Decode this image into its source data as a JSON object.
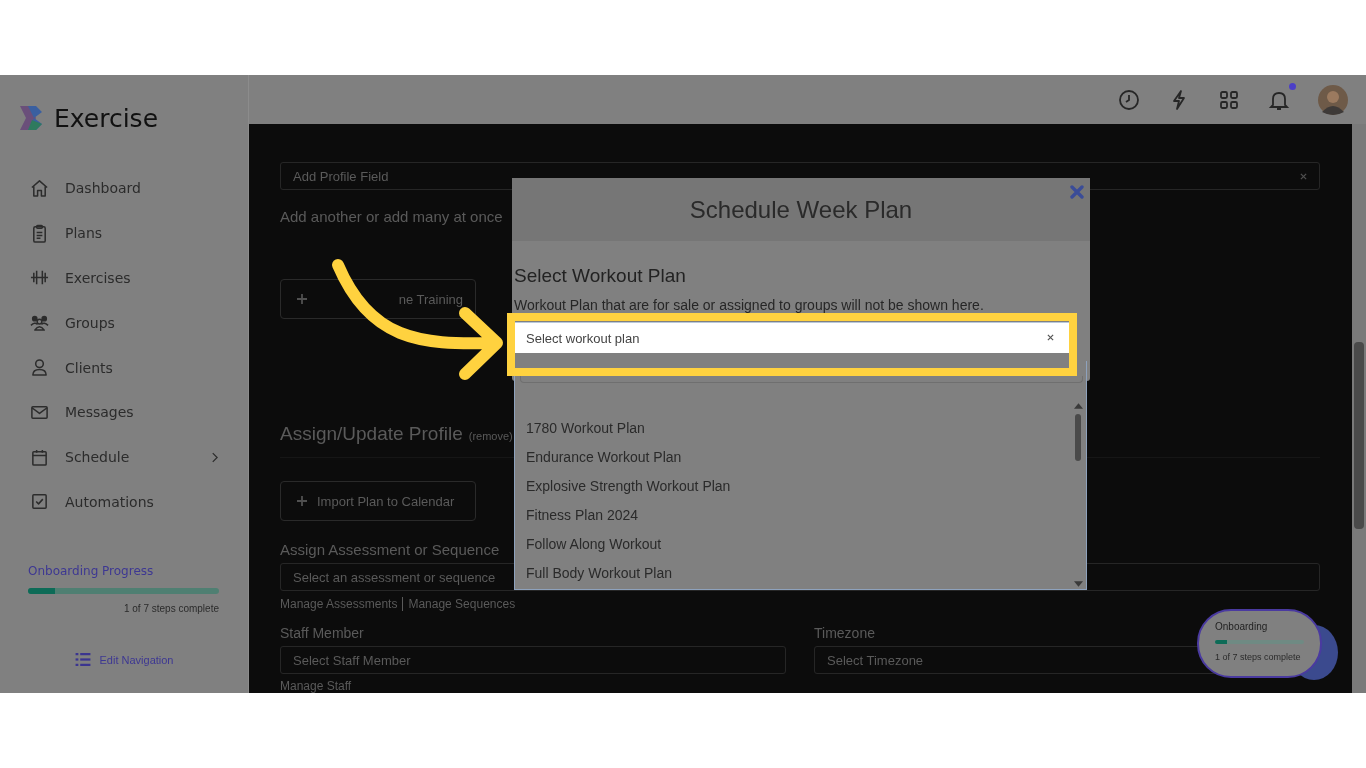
{
  "brand": {
    "name": "Exercise"
  },
  "sidebar": {
    "items": [
      {
        "label": "Dashboard",
        "selected": false,
        "expandable": false
      },
      {
        "label": "Plans",
        "selected": false,
        "expandable": false
      },
      {
        "label": "Exercises",
        "selected": false,
        "expandable": false
      },
      {
        "label": "Groups",
        "selected": false,
        "expandable": false
      },
      {
        "label": "Clients",
        "selected": false,
        "expandable": false
      },
      {
        "label": "Messages",
        "selected": false,
        "expandable": false
      },
      {
        "label": "Schedule",
        "selected": false,
        "expandable": true
      },
      {
        "label": "Automations",
        "selected": false,
        "expandable": false
      }
    ],
    "onboarding": {
      "title": "Onboarding Progress",
      "level": 0.14,
      "steps": "1 of 7 steps complete"
    },
    "edit_navigation": "Edit Navigation"
  },
  "topbar": {
    "notifications_unread": true
  },
  "background_page": {
    "profile_field": {
      "placeholder": "Add Profile Field"
    },
    "add_note": "Add another or add many at once",
    "training_button": "ne Training",
    "section_title": "Assign/Update Profile",
    "section_remove": "(remove)",
    "import_button": "Import Plan to Calendar",
    "assessment_label": "Assign Assessment or Sequence",
    "assessment_select": {
      "placeholder": "Select an assessment or sequence"
    },
    "manage_links": [
      "Manage Assessments",
      "Manage Sequences"
    ],
    "staff_label": "Staff Member",
    "staff_select": {
      "placeholder": "Select Staff Member"
    },
    "manage_staff": "Manage Staff",
    "timezone_label": "Timezone",
    "timezone_select": {
      "placeholder": "Select Timezone"
    }
  },
  "modal": {
    "title": "Schedule Week Plan",
    "heading": "Select Workout Plan",
    "note": "Workout Plan that are for sale or assigned to groups will not be shown here.",
    "select": {
      "placeholder": "Select workout plan"
    },
    "options": [
      {
        "label": "1780 Workout Plan",
        "selected": false
      },
      {
        "label": "Endurance Workout Plan",
        "selected": false
      },
      {
        "label": "Explosive Strength Workout Plan",
        "selected": false
      },
      {
        "label": "Fitness Plan 2024",
        "selected": false
      },
      {
        "label": "Follow Along Workout",
        "selected": false
      },
      {
        "label": "Full Body Workout Plan",
        "selected": false
      }
    ]
  },
  "onboarding_widget": {
    "title": "Onboarding",
    "level": 0.14,
    "steps": "1 of 7 steps complete"
  }
}
